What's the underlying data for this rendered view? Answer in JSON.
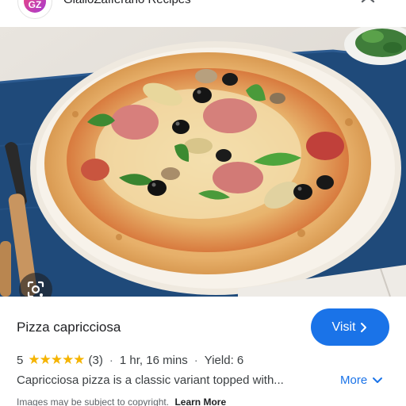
{
  "header": {
    "site_name": "GialloZafferano Recipes",
    "logo_text": "GZ",
    "logo_icon": "gz-logo-icon",
    "menu_icon": "more-vert-icon",
    "close_icon": "close-icon"
  },
  "image": {
    "alt": "Pizza capricciosa",
    "lens_icon": "google-lens-icon"
  },
  "result": {
    "title": "Pizza capricciosa",
    "visit_label": "Visit",
    "rating_value": "5",
    "stars": "★★★★★",
    "review_count": "(3)",
    "separator": "·",
    "time": "1 hr, 16 mins",
    "yield": "Yield: 6",
    "description": "Capricciosa pizza is a classic variant topped with...",
    "more_label": "More",
    "disclaimer": "Images may be subject to copyright.",
    "learn_more": "Learn More"
  },
  "colors": {
    "accent": "#1a73e8",
    "star": "#f5b400",
    "tablecloth": "#1f4a7a"
  }
}
